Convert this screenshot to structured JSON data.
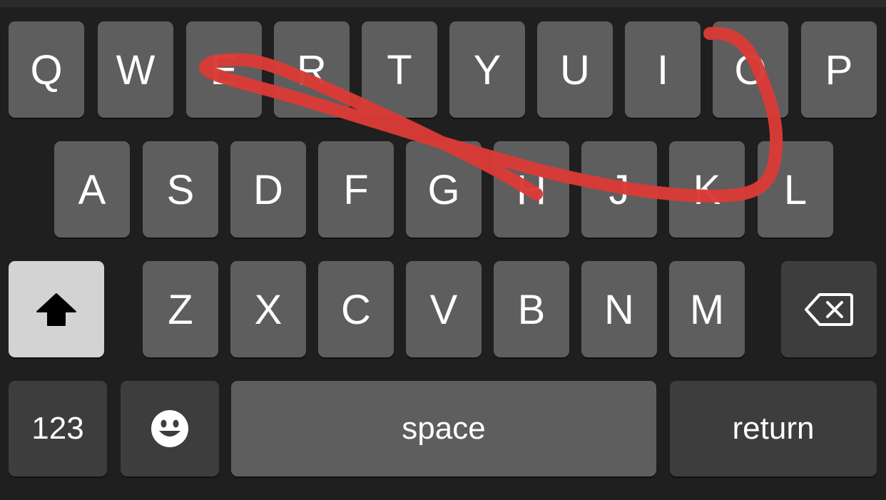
{
  "keyboard": {
    "row1": [
      "Q",
      "W",
      "E",
      "R",
      "T",
      "Y",
      "U",
      "I",
      "O",
      "P"
    ],
    "row2": [
      "A",
      "S",
      "D",
      "F",
      "G",
      "H",
      "J",
      "K",
      "L"
    ],
    "row3": [
      "Z",
      "X",
      "C",
      "V",
      "B",
      "N",
      "M"
    ],
    "bottom": {
      "numbers_label": "123",
      "space_label": "space",
      "return_label": "return"
    },
    "icons": {
      "shift": "shift-arrow-icon",
      "backspace": "backspace-icon",
      "emoji": "emoji-smiley-icon"
    },
    "shift_active": true
  },
  "annotation": {
    "stroke_color": "#d93b36"
  },
  "colors": {
    "background": "#1f1f1f",
    "key": "#5e5e5e",
    "key_dark": "#3d3d3d",
    "key_active": "#d3d3d3",
    "text": "#ffffff"
  }
}
